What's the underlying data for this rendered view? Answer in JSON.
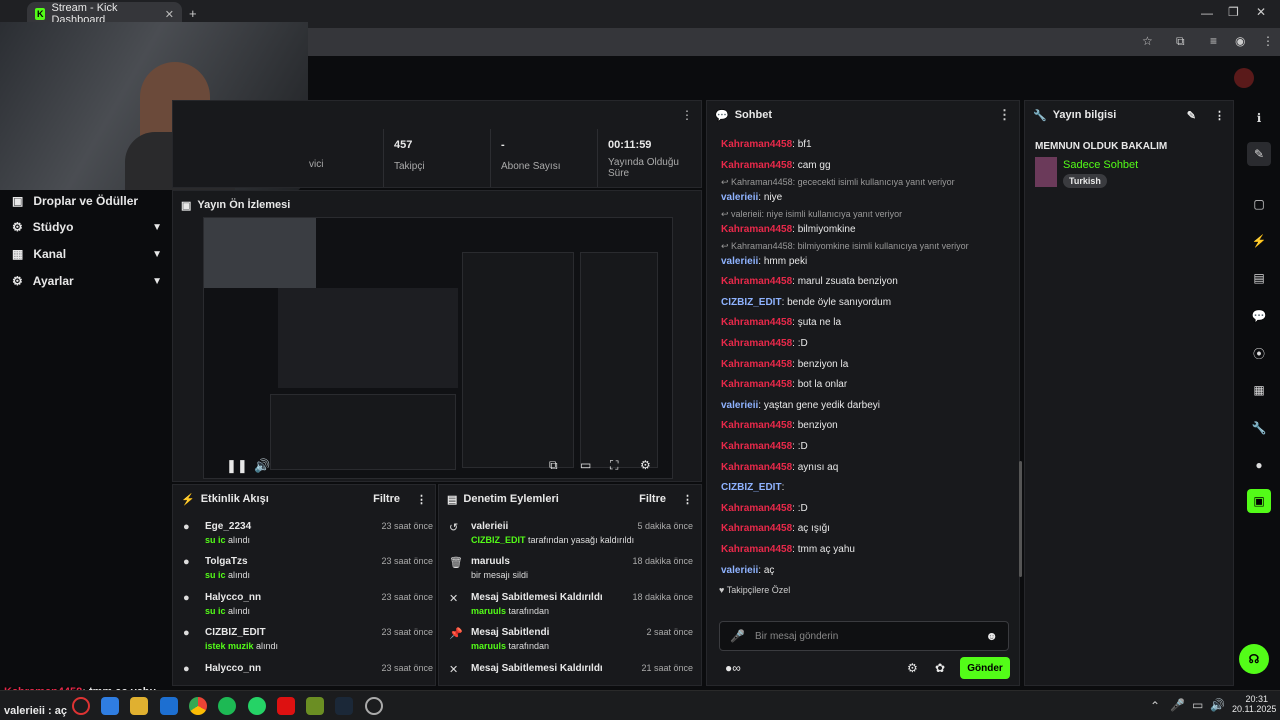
{
  "browser": {
    "tab_title": "Stream - Kick Dashboard",
    "new_tab": "+"
  },
  "sidebar": {
    "items": [
      {
        "label": "Droplar ve Ödüller"
      },
      {
        "label": "Stüdyo"
      },
      {
        "label": "Kanal"
      },
      {
        "label": "Ayarlar"
      }
    ]
  },
  "stats": {
    "partial_label": "vici",
    "followers_value": "457",
    "followers_label": "Takipçi",
    "subs_value": "-",
    "subs_label": "Abone Sayısı",
    "duration_value": "00:11:59",
    "duration_label": "Yayında Olduğu Süre"
  },
  "preview": {
    "title": "Yayın Ön İzlemesi"
  },
  "events": {
    "title": "Etkinlik Akışı",
    "filter": "Filtre",
    "items": [
      {
        "name": "Ege_2234",
        "highlight": "su ic",
        "rest": " alındı",
        "time": "23 saat önce"
      },
      {
        "name": "TolgaTzs",
        "highlight": "su ic",
        "rest": " alındı",
        "time": "23 saat önce"
      },
      {
        "name": "Halycco_nn",
        "highlight": "su ic",
        "rest": " alındı",
        "time": "23 saat önce"
      },
      {
        "name": "CIZBIZ_EDIT",
        "highlight": "istek muzik",
        "rest": " alındı",
        "time": "23 saat önce"
      },
      {
        "name": "Halycco_nn",
        "highlight": "",
        "rest": "",
        "time": "23 saat önce"
      }
    ]
  },
  "moderation": {
    "title": "Denetim Eylemleri",
    "filter": "Filtre",
    "items": [
      {
        "name": "valerieii",
        "highlight": "CIZBIZ_EDIT",
        "rest": " tarafından yasağı kaldırıldı",
        "time": "5 dakika önce"
      },
      {
        "name": "maruuls",
        "highlight": "",
        "rest": "bir mesajı sildi",
        "time": "18 dakika önce"
      },
      {
        "name": "Mesaj Sabitlemesi Kaldırıldı",
        "highlight": "maruuls",
        "rest": " tarafından",
        "time": "18 dakika önce"
      },
      {
        "name": "Mesaj Sabitlendi",
        "highlight": "maruuls",
        "rest": " tarafından",
        "time": "2 saat önce"
      },
      {
        "name": "Mesaj Sabitlemesi Kaldırıldı",
        "highlight": "",
        "rest": "",
        "time": "21 saat önce"
      }
    ]
  },
  "chat": {
    "title": "Sohbet",
    "placeholder": "Bir mesaj gönderin",
    "send": "Gönder",
    "followers_only": "Takipçilere Özel",
    "messages": [
      {
        "user": "Kahraman4458",
        "text": ": bf1",
        "c": "r"
      },
      {
        "user": "Kahraman4458",
        "text": ": cam gg",
        "c": "r"
      },
      {
        "reply": "Kahraman4458: gececekti isimli kullanıcıya yanıt veriyor"
      },
      {
        "user": "valerieii",
        "text": ": niye",
        "c": "b"
      },
      {
        "reply": "valerieii: niye isimli kullanıcıya yanıt veriyor"
      },
      {
        "user": "Kahraman4458",
        "text": ": bilmiyomkine",
        "c": "r"
      },
      {
        "reply": "Kahraman4458: bilmiyomkine isimli kullanıcıya yanıt veriyor"
      },
      {
        "user": "valerieii",
        "text": ": hmm peki",
        "c": "b"
      },
      {
        "user": "Kahraman4458",
        "text": ": marul zsuata benziyon",
        "c": "r"
      },
      {
        "user": "CIZBIZ_EDIT",
        "text": ": bende öyle sanıyordum",
        "c": "b"
      },
      {
        "user": "Kahraman4458",
        "text": ": şuta ne la",
        "c": "r"
      },
      {
        "user": "Kahraman4458",
        "text": ": :D",
        "c": "r"
      },
      {
        "user": "Kahraman4458",
        "text": ": benziyon la",
        "c": "r"
      },
      {
        "user": "Kahraman4458",
        "text": ": bot la onlar",
        "c": "r"
      },
      {
        "user": "valerieii",
        "text": ": yaştan gene yedik darbeyi",
        "c": "b"
      },
      {
        "user": "Kahraman4458",
        "text": ": benziyon",
        "c": "r"
      },
      {
        "user": "Kahraman4458",
        "text": ": :D",
        "c": "r"
      },
      {
        "user": "Kahraman4458",
        "text": ": aynısı aq",
        "c": "r"
      },
      {
        "user": "CIZBIZ_EDIT",
        "text": ":",
        "c": "b"
      },
      {
        "user": "Kahraman4458",
        "text": ": :D",
        "c": "r"
      },
      {
        "user": "Kahraman4458",
        "text": ": aç ışığı",
        "c": "r"
      },
      {
        "user": "Kahraman4458",
        "text": ": tmm aç yahu",
        "c": "r"
      },
      {
        "user": "valerieii",
        "text": ": aç",
        "c": "b"
      }
    ]
  },
  "info": {
    "title": "Yayın bilgisi",
    "stream_title": "MEMNUN OLDUK BAKALIM",
    "category": "Sadece Sohbet",
    "tag": "Turkish"
  },
  "overlay": {
    "line1_user": "Kahraman4458",
    "line1_text": ": tmm aç yahu",
    "line2": "valerieii : aç"
  },
  "taskbar": {
    "time": "20:31",
    "date": "20.11.2025"
  },
  "colors": {
    "accent": "#53fc18",
    "name_red": "#e8294a",
    "name_blue": "#8fb3ff"
  }
}
